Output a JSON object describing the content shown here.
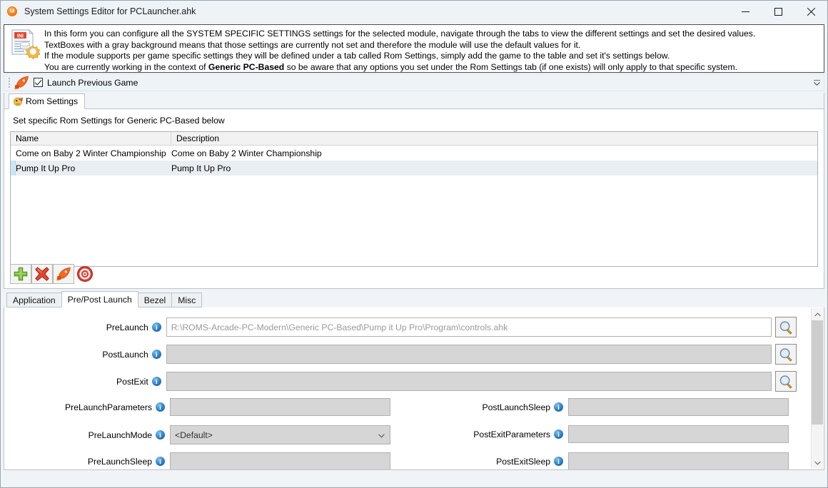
{
  "window": {
    "title": "System Settings Editor for PCLauncher.ahk",
    "icon": "app-logo-icon",
    "minimize_label": "Minimize",
    "maximize_label": "Maximize",
    "close_label": "Close"
  },
  "info_panel": {
    "icon": "ini-settings-icon",
    "lines": [
      "In this form you can configure all the SYSTEM SPECIFIC SETTINGS settings for the selected module, navigate through the tabs to view the different settings and set the desired values.",
      "TextBoxes with a gray background means that those settings are currently not set and therefore the module will use the default values for it.",
      "If the module supports per game specific settings they will be defined under a tab called Rom Settings, simply add the game to the table and set it's settings below."
    ],
    "last_line_prefix": "You are currently working in the context of ",
    "last_line_bold": "Generic PC-Based",
    "last_line_suffix": " so be aware that any options you set under the Rom Settings tab (if one exists) will only apply to that specific system."
  },
  "toolbar": {
    "rocket_icon": "rocket-icon",
    "launch_previous_game_label": "Launch Previous Game",
    "launch_previous_game_checked": true,
    "overflow_label": "Toolbar overflow"
  },
  "rom_tab": {
    "label": "Rom Settings",
    "icon": "rom-chip-icon",
    "section_label": "Set specific Rom Settings for Generic PC-Based below"
  },
  "grid": {
    "columns": [
      "Name",
      "Description"
    ],
    "rows": [
      {
        "name": "Come on Baby 2 Winter Championship",
        "description": "Come on Baby 2 Winter Championship",
        "selected": false
      },
      {
        "name": "Pump It Up Pro",
        "description": "Pump It Up Pro",
        "selected": true
      }
    ]
  },
  "grid_toolbar": {
    "buttons": [
      {
        "name": "add-rom-button",
        "icon": "green-plus-icon",
        "label": "Add"
      },
      {
        "name": "delete-rom-button",
        "icon": "red-x-icon",
        "label": "Delete"
      },
      {
        "name": "launch-rom-button",
        "icon": "rocket-icon",
        "label": "Launch"
      },
      {
        "name": "target-button",
        "icon": "target-icon",
        "label": "Target"
      }
    ]
  },
  "bottom_tabs": [
    {
      "label": "Application",
      "active": false
    },
    {
      "label": "Pre/Post Launch",
      "active": true
    },
    {
      "label": "Bezel",
      "active": false
    },
    {
      "label": "Misc",
      "active": false
    }
  ],
  "form": {
    "prelaunch": {
      "label": "PreLaunch",
      "value": "R:\\ROMS-Arcade-PC-Modern\\Generic PC-Based\\Pump it Up Pro\\Program\\controls.ahk",
      "empty": false
    },
    "postlaunch": {
      "label": "PostLaunch",
      "value": "",
      "empty": true
    },
    "postexit": {
      "label": "PostExit",
      "value": "",
      "empty": true
    },
    "prelaunchparameters": {
      "label": "PreLaunchParameters",
      "value": "",
      "empty": true
    },
    "prelaunchmode": {
      "label": "PreLaunchMode",
      "value": "<Default>"
    },
    "prelaunchsleep": {
      "label": "PreLaunchSleep",
      "value": "",
      "empty": true
    },
    "postlaunchsleep": {
      "label": "PostLaunchSleep",
      "value": "",
      "empty": true
    },
    "postexitparameters": {
      "label": "PostExitParameters",
      "value": "",
      "empty": true
    },
    "postexitsleep": {
      "label": "PostExitSleep",
      "value": "",
      "empty": true
    },
    "browse_icon": "magnifier-icon",
    "info_icon": "info-icon"
  },
  "colors": {
    "accent": "#f58220",
    "titlebar": "#eef3f7",
    "selection": "#e9eef2",
    "disabled_field": "#d6d6d6"
  }
}
